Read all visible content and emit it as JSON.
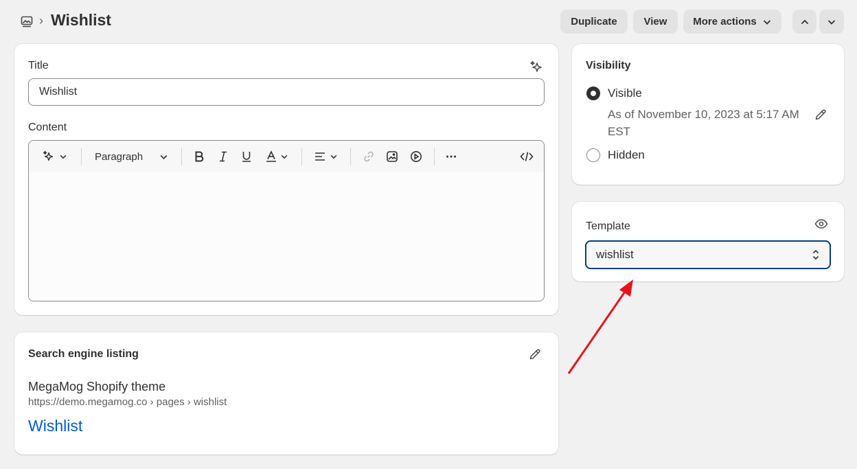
{
  "header": {
    "title": "Wishlist",
    "breadcrumb_separator": "›",
    "duplicate_label": "Duplicate",
    "view_label": "View",
    "more_actions_label": "More actions"
  },
  "main": {
    "title_label": "Title",
    "title_value": "Wishlist",
    "content_label": "Content",
    "format_select": "Paragraph"
  },
  "seo": {
    "heading": "Search engine listing",
    "site_name": "MegaMog Shopify theme",
    "url": "https://demo.megamog.co › pages › wishlist",
    "page_title": "Wishlist"
  },
  "visibility": {
    "heading": "Visibility",
    "visible_label": "Visible",
    "visible_note": "As of November 10, 2023 at 5:17 AM EST",
    "hidden_label": "Hidden",
    "selected": "Visible"
  },
  "template": {
    "heading": "Template",
    "value": "wishlist"
  },
  "colors": {
    "link": "#005bd3",
    "focus_border": "#003a8c",
    "annotation_arrow": "#e8141b"
  }
}
